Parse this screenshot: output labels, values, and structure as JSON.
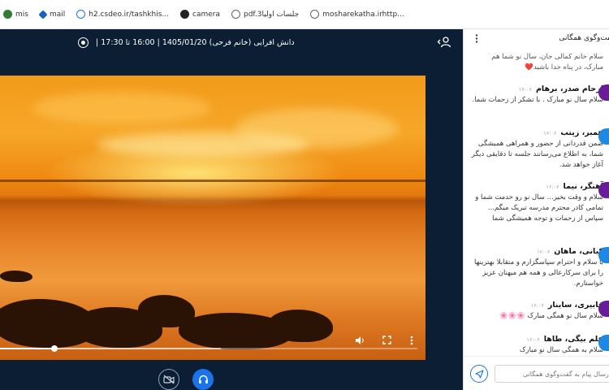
{
  "bookmarks": [
    {
      "label": "mis",
      "icon": "globe-icon",
      "color": "#2e7d32"
    },
    {
      "label": "mail",
      "icon": "mail-icon",
      "color": "#1565c0"
    },
    {
      "label": "h2.csdeo.ir/tashkhis...",
      "icon": "globe-icon",
      "color": "#1a73e8"
    },
    {
      "label": "camera",
      "icon": "camera-icon",
      "color": "#222222"
    },
    {
      "label": "pdf.3جلسات اولیا",
      "icon": "globe-icon",
      "color": "#5f6368"
    },
    {
      "label": "mosharekatha.irhttp...",
      "icon": "globe-icon",
      "color": "#5f6368"
    }
  ],
  "session": {
    "title": "دانش افرایی (خانم فرحی) 1405/01/20 | 16:00 تا 17:30 |"
  },
  "video": {
    "progress": 0.13,
    "buffered": 0.53
  },
  "chat": {
    "title": "گفت‌وگوی همگانی",
    "input_placeholder": "ارسال پیام به گفت‌وگوی همگانی",
    "messages": [
      {
        "name": "",
        "time": "",
        "text": "سلام خانم کمالی جان، سال نو شما هم مبارک، در پناه خدا باشید❤️",
        "avatar_color": "#ffffff"
      },
      {
        "name": "ارحام صدر، برهام",
        "time": "۱۶:۰۶",
        "text": "سلام سال نو مبارک . با تشکر از زحمات شما.",
        "avatar_color": "#6a1b9a"
      },
      {
        "name": "همبر، زینب",
        "time": "۱۶:۰۶",
        "text": "ضمن قدردانی از حضور و همراهی همیشگی شما، به اطلاع می‌رسانند جلسه تا دقایقی دیگر آغاز خواهد شد.",
        "avatar_color": "#1e88e5"
      },
      {
        "name": "آهنگر، نیما",
        "time": "۱۶:۰۶",
        "text": "سلام و وقت بخیر... سال نو رو خدمت شما و تمامی کادر محترم مدرسه تبریک میگم... سپاس از زحمات و توجه همیشگی شما",
        "avatar_color": "#6a1b9a"
      },
      {
        "name": "کیانی، ماهان",
        "time": "۱۶:۰۶",
        "text": "با سلام و احترام سپاسگزارم و متقابلا بهترینها را برای سرکارعالی و همه هم میهنان عزیز خواستارم.",
        "avatar_color": "#1e88e5"
      },
      {
        "name": "قابیری، ساینار",
        "time": "۱۶:۰۶",
        "text": "سلام سال نو همگی مبارک 🌸🌸🌸",
        "avatar_color": "#6a1b9a"
      },
      {
        "name": "علم بیگی، طاها",
        "time": "۱۶:۰۶",
        "text": "سلام به همگی سال نو مبارک",
        "avatar_color": "#1e88e5"
      }
    ]
  }
}
